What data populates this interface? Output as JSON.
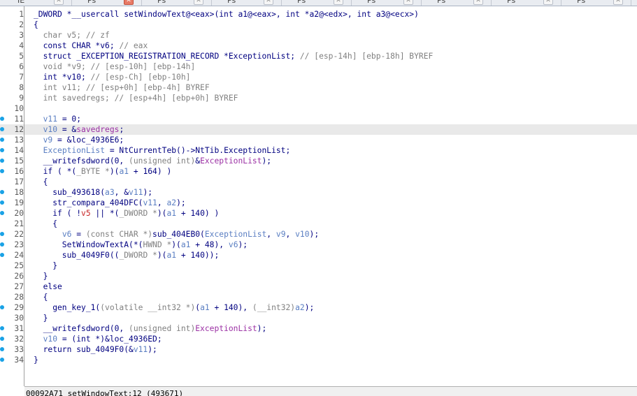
{
  "tabs": [
    {
      "label": "IE",
      "active": false
    },
    {
      "label": "Ps",
      "active": true
    },
    {
      "label": "Ps",
      "active": false
    },
    {
      "label": "Ps",
      "active": false
    },
    {
      "label": "Ps",
      "active": false
    },
    {
      "label": "Ps",
      "active": false
    },
    {
      "label": "Ps",
      "active": false
    },
    {
      "label": "Ps",
      "active": false
    },
    {
      "label": "Ps",
      "active": false
    }
  ],
  "editor": {
    "current_line": 12,
    "lines": [
      {
        "num": "1",
        "dot": false,
        "tokens": [
          [
            "_DWORD *__usercall setWindowText@<eax>(int a1@<eax>, int *a2@<edx>, int a3@<ecx>)",
            "n"
          ]
        ]
      },
      {
        "num": "2",
        "dot": false,
        "tokens": [
          [
            "{",
            "n"
          ]
        ]
      },
      {
        "num": "3",
        "dot": false,
        "tokens": [
          [
            "  char v5; // zf",
            "g"
          ]
        ]
      },
      {
        "num": "4",
        "dot": false,
        "tokens": [
          [
            "  const CHAR *v6; ",
            "n"
          ],
          [
            "// eax",
            "g"
          ]
        ]
      },
      {
        "num": "5",
        "dot": false,
        "tokens": [
          [
            "  struct _EXCEPTION_REGISTRATION_RECORD *ExceptionList; ",
            "n"
          ],
          [
            "// [esp-14h] [ebp-18h] BYREF",
            "g"
          ]
        ]
      },
      {
        "num": "6",
        "dot": false,
        "tokens": [
          [
            "  void *v9; // [esp-10h] [ebp-14h]",
            "g"
          ]
        ]
      },
      {
        "num": "7",
        "dot": false,
        "tokens": [
          [
            "  int *v10; ",
            "n"
          ],
          [
            "// [esp-Ch] [ebp-10h]",
            "g"
          ]
        ]
      },
      {
        "num": "8",
        "dot": false,
        "tokens": [
          [
            "  int v11; // [esp+0h] [ebp-4h] BYREF",
            "g"
          ]
        ]
      },
      {
        "num": "9",
        "dot": false,
        "tokens": [
          [
            "  int savedregs; // [esp+4h] [ebp+0h] BYREF",
            "g"
          ]
        ]
      },
      {
        "num": "10",
        "dot": false,
        "tokens": [
          [
            "",
            "n"
          ]
        ]
      },
      {
        "num": "11",
        "dot": true,
        "tokens": [
          [
            "  ",
            "n"
          ],
          [
            "v11",
            "b"
          ],
          [
            " = 0;",
            "n"
          ]
        ]
      },
      {
        "num": "12",
        "dot": true,
        "tokens": [
          [
            "  ",
            "n"
          ],
          [
            "v10",
            "b"
          ],
          [
            " = &",
            "n"
          ],
          [
            "savedregs",
            "m"
          ],
          [
            ";",
            "n"
          ]
        ]
      },
      {
        "num": "13",
        "dot": true,
        "tokens": [
          [
            "  ",
            "n"
          ],
          [
            "v9",
            "b"
          ],
          [
            " = &loc_4936E6;",
            "n"
          ]
        ]
      },
      {
        "num": "14",
        "dot": true,
        "tokens": [
          [
            "  ",
            "n"
          ],
          [
            "ExceptionList",
            "b"
          ],
          [
            " = NtCurrentTeb()->NtTib.ExceptionList;",
            "n"
          ]
        ]
      },
      {
        "num": "15",
        "dot": true,
        "tokens": [
          [
            "  __writefsdword(0, ",
            "n"
          ],
          [
            "(unsigned int)",
            "g"
          ],
          [
            "&",
            "n"
          ],
          [
            "ExceptionList",
            "m"
          ],
          [
            ");",
            "n"
          ]
        ]
      },
      {
        "num": "16",
        "dot": true,
        "tokens": [
          [
            "  if ( *(",
            "n"
          ],
          [
            "_BYTE *",
            "g"
          ],
          [
            ")(",
            "n"
          ],
          [
            "a1",
            "b"
          ],
          [
            " + 164) )",
            "n"
          ]
        ]
      },
      {
        "num": "17",
        "dot": false,
        "tokens": [
          [
            "  {",
            "n"
          ]
        ]
      },
      {
        "num": "18",
        "dot": true,
        "tokens": [
          [
            "    sub_493618(",
            "n"
          ],
          [
            "a3",
            "b"
          ],
          [
            ", &",
            "n"
          ],
          [
            "v11",
            "b"
          ],
          [
            ");",
            "n"
          ]
        ]
      },
      {
        "num": "19",
        "dot": true,
        "tokens": [
          [
            "    str_compara_404DFC(",
            "n"
          ],
          [
            "v11",
            "b"
          ],
          [
            ", ",
            "n"
          ],
          [
            "a2",
            "b"
          ],
          [
            ");",
            "n"
          ]
        ]
      },
      {
        "num": "20",
        "dot": true,
        "tokens": [
          [
            "    if ( !",
            "n"
          ],
          [
            "v5",
            "r"
          ],
          [
            " || *(",
            "n"
          ],
          [
            "_DWORD *",
            "g"
          ],
          [
            ")(",
            "n"
          ],
          [
            "a1",
            "b"
          ],
          [
            " + 140) )",
            "n"
          ]
        ]
      },
      {
        "num": "21",
        "dot": false,
        "tokens": [
          [
            "    {",
            "n"
          ]
        ]
      },
      {
        "num": "22",
        "dot": true,
        "tokens": [
          [
            "      ",
            "n"
          ],
          [
            "v6",
            "b"
          ],
          [
            " = ",
            "n"
          ],
          [
            "(const CHAR *)",
            "g"
          ],
          [
            "sub_404EB0(",
            "n"
          ],
          [
            "ExceptionList",
            "b"
          ],
          [
            ", ",
            "n"
          ],
          [
            "v9",
            "b"
          ],
          [
            ", ",
            "n"
          ],
          [
            "v10",
            "b"
          ],
          [
            ");",
            "n"
          ]
        ]
      },
      {
        "num": "23",
        "dot": true,
        "tokens": [
          [
            "      SetWindowTextA(*(",
            "n"
          ],
          [
            "HWND *",
            "g"
          ],
          [
            ")(",
            "n"
          ],
          [
            "a1",
            "b"
          ],
          [
            " + 48), ",
            "n"
          ],
          [
            "v6",
            "b"
          ],
          [
            ");",
            "n"
          ]
        ]
      },
      {
        "num": "24",
        "dot": true,
        "tokens": [
          [
            "      sub_4049F0((",
            "n"
          ],
          [
            "_DWORD *",
            "g"
          ],
          [
            ")(",
            "n"
          ],
          [
            "a1",
            "b"
          ],
          [
            " + 140));",
            "n"
          ]
        ]
      },
      {
        "num": "25",
        "dot": false,
        "tokens": [
          [
            "    }",
            "n"
          ]
        ]
      },
      {
        "num": "26",
        "dot": false,
        "tokens": [
          [
            "  }",
            "n"
          ]
        ]
      },
      {
        "num": "27",
        "dot": false,
        "tokens": [
          [
            "  else",
            "n"
          ]
        ]
      },
      {
        "num": "28",
        "dot": false,
        "tokens": [
          [
            "  {",
            "n"
          ]
        ]
      },
      {
        "num": "29",
        "dot": true,
        "tokens": [
          [
            "    gen_key_1(",
            "n"
          ],
          [
            "(volatile __int32 *)",
            "g"
          ],
          [
            "(",
            "n"
          ],
          [
            "a1",
            "b"
          ],
          [
            " + 140), ",
            "n"
          ],
          [
            "(__int32)",
            "g"
          ],
          [
            "a2",
            "b"
          ],
          [
            ");",
            "n"
          ]
        ]
      },
      {
        "num": "30",
        "dot": false,
        "tokens": [
          [
            "  }",
            "n"
          ]
        ]
      },
      {
        "num": "31",
        "dot": true,
        "tokens": [
          [
            "  __writefsdword(0, ",
            "n"
          ],
          [
            "(unsigned int)",
            "g"
          ],
          [
            "ExceptionList",
            "m"
          ],
          [
            ");",
            "n"
          ]
        ]
      },
      {
        "num": "32",
        "dot": true,
        "tokens": [
          [
            "  ",
            "n"
          ],
          [
            "v10",
            "b"
          ],
          [
            " = (int *)&loc_4936ED;",
            "n"
          ]
        ]
      },
      {
        "num": "33",
        "dot": true,
        "tokens": [
          [
            "  return sub_4049F0(&",
            "n"
          ],
          [
            "v11",
            "b"
          ],
          [
            ");",
            "n"
          ]
        ]
      },
      {
        "num": "34",
        "dot": true,
        "tokens": [
          [
            "}",
            "n"
          ]
        ]
      }
    ]
  },
  "status": {
    "text": "00092A71 setWindowText:12 (493671)"
  }
}
